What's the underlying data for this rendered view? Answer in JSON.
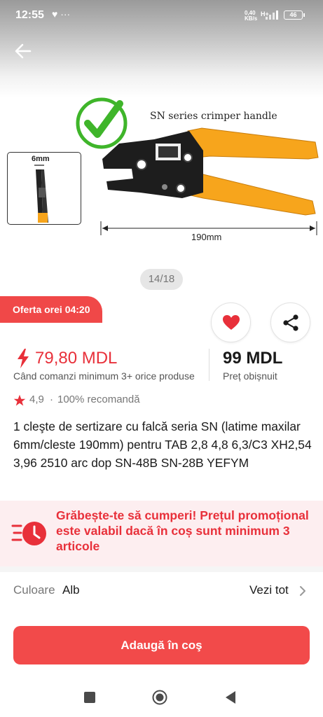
{
  "status_bar": {
    "time": "12:55",
    "left_icons": "♥ ···",
    "net_speed": "0,40\nKB/s",
    "signal_type": "H+",
    "battery": "46"
  },
  "product_image": {
    "caption": "SN series crimper handle",
    "thumbnail_label": "6mm",
    "dimension_label": "190mm",
    "page_indicator": "14/18"
  },
  "offer": {
    "label": "Oferta orei 04:20"
  },
  "price": {
    "sale": "79,80 MDL",
    "sale_condition": "Când comanzi minimum 3+ orice produse",
    "regular": "99 MDL",
    "regular_label": "Preț obișnuit"
  },
  "rating": {
    "value": "4,9",
    "separator": "·",
    "recommend": "100% recomandă"
  },
  "title": "1 cleşte de sertizare cu falcă seria SN (latime maxilar 6mm/cleste 190mm) pentru TAB 2,8 4,8 6,3/C3 XH2,54 3,96 2510 arc dop SN-48B SN-28B YEFYM",
  "promo": {
    "text": "Grăbește-te să cumperi! Prețul promoțional este valabil dacă în coș sunt minimum 3 articole"
  },
  "color": {
    "label": "Culoare",
    "value": "Alb",
    "see_all": "Vezi tot"
  },
  "cart": {
    "button_label": "Adaugă în coş"
  },
  "colors": {
    "accent": "#f04848",
    "price_red": "#e8303a",
    "promo_bg": "#fdeef0",
    "handle_orange": "#f7a51c",
    "check_green": "#3fb52a"
  },
  "icons": [
    "arrow-left-icon",
    "checkmark-icon",
    "heart-icon",
    "share-icon",
    "bolt-icon",
    "star-icon",
    "clock-alarm-icon",
    "chevron-right-icon",
    "nav-square-icon",
    "nav-home-icon",
    "nav-back-icon"
  ]
}
